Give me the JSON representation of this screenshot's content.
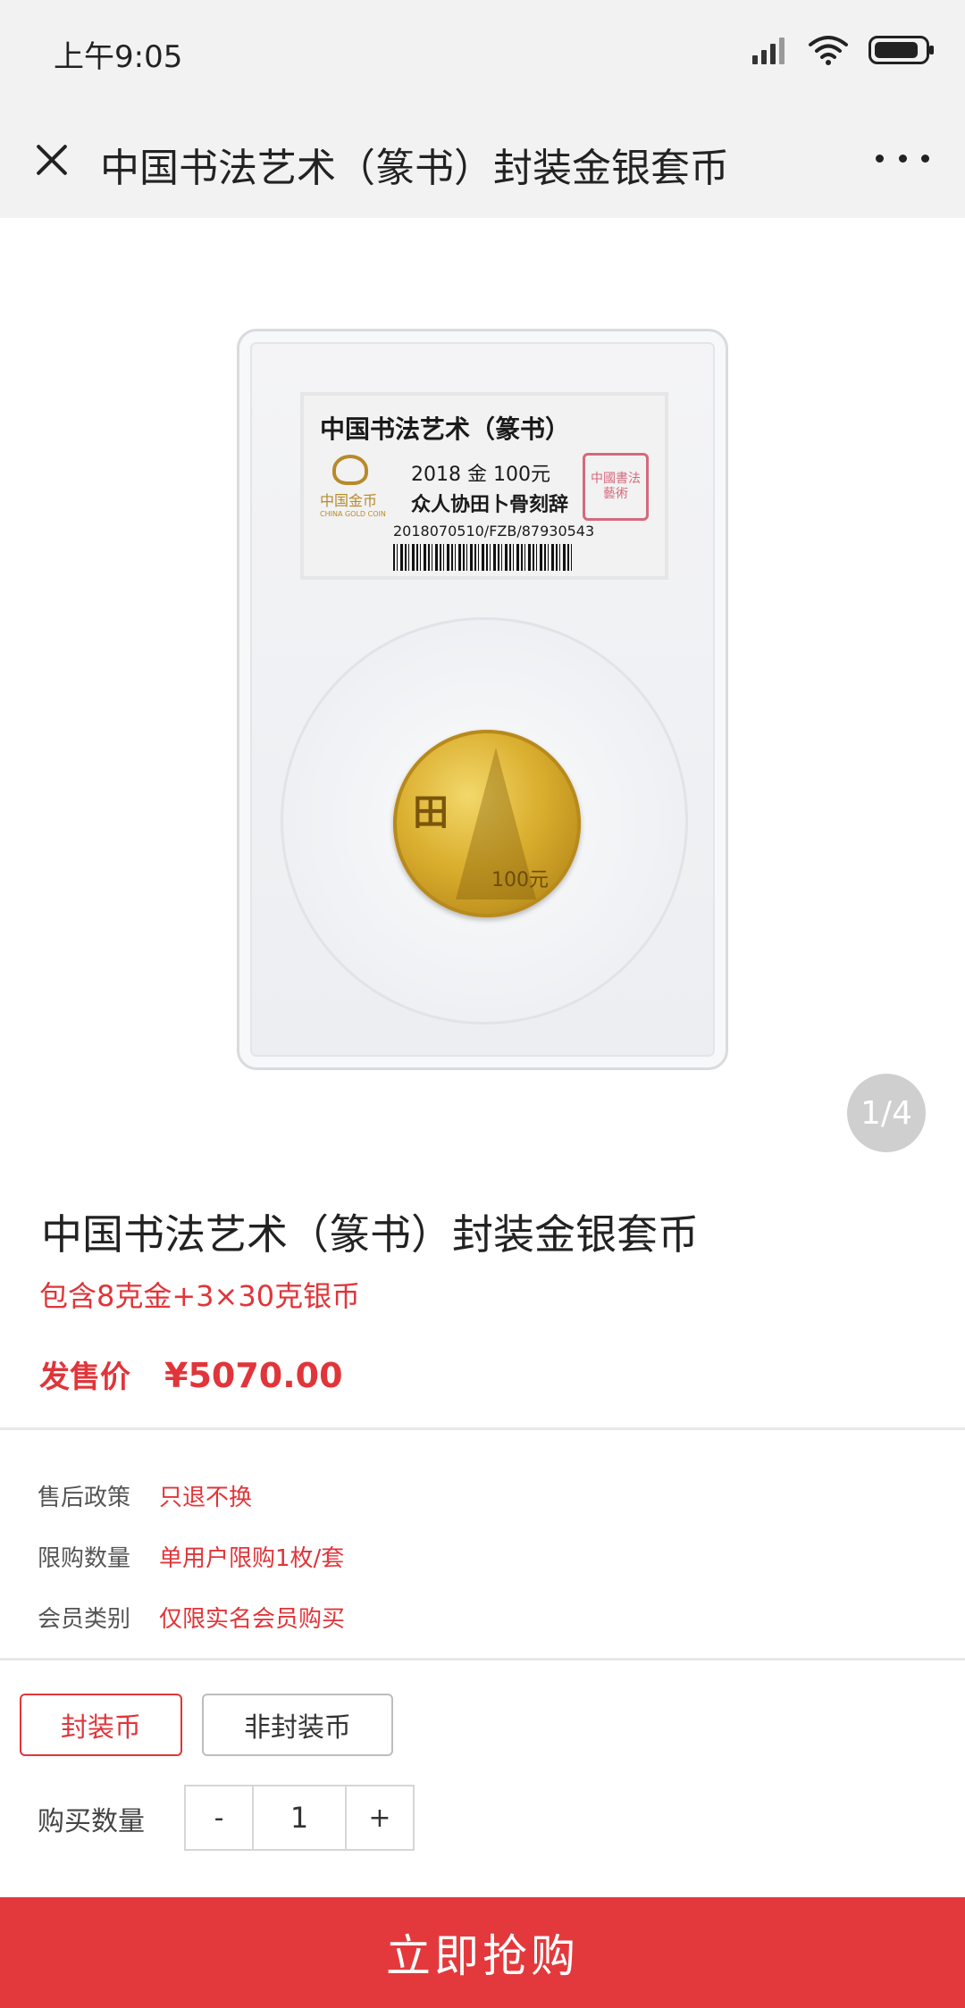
{
  "status_bar": {
    "time": "上午9:05",
    "icons": [
      "signal-icon",
      "wifi-icon",
      "battery-icon"
    ]
  },
  "nav": {
    "title": "中国书法艺术（篆书）封装金银套币",
    "close_icon": "close-icon",
    "more_icon": "more-icon"
  },
  "gallery": {
    "pager": "1/4",
    "slab_label": {
      "title": "中国书法艺术（篆书）",
      "logo_text": "中国金币",
      "logo_subtext": "CHINA GOLD COIN",
      "line2": "2018   金   100元",
      "line3": "众人协田卜骨刻辞",
      "serial": "2018070510/FZB/87930543",
      "seal_text": "中國書法藝術"
    },
    "coin": {
      "glyph": "田",
      "value": "100元"
    }
  },
  "product": {
    "title": "中国书法艺术（篆书）封装金银套币",
    "subtitle": "包含8克金+3×30克银币",
    "price_label": "发售价",
    "price_value": "¥5070.00"
  },
  "policies": [
    {
      "key": "售后政策",
      "value": "只退不换"
    },
    {
      "key": "限购数量",
      "value": "单用户限购1枚/套"
    },
    {
      "key": "会员类别",
      "value": "仅限实名会员购买"
    }
  ],
  "options": {
    "active": "封装币",
    "inactive": "非封装币"
  },
  "quantity": {
    "label": "购买数量",
    "minus": "-",
    "value": "1",
    "plus": "+"
  },
  "buy_button": "立即抢购",
  "colors": {
    "accent": "#e0353a",
    "buy_button": "#e4393c",
    "nav_bg": "#f3f2f2"
  }
}
